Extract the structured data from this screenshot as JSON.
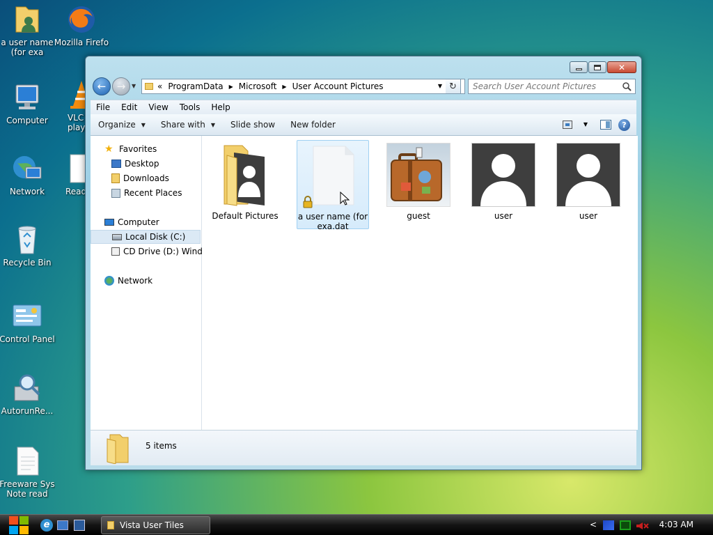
{
  "desktop": {
    "icons": [
      {
        "label": "a user name (for exa"
      },
      {
        "label": "Mozilla Firefo"
      },
      {
        "label": "Computer"
      },
      {
        "label": "VLC m play"
      },
      {
        "label": "Network"
      },
      {
        "label": "Read"
      },
      {
        "label": "Recycle Bin"
      },
      {
        "label": "Control Panel"
      },
      {
        "label": "AutorunRe..."
      },
      {
        "label": "Freeware Sys Note read this"
      }
    ]
  },
  "window": {
    "address": {
      "overflow": "«",
      "crumbs": [
        "ProgramData",
        "Microsoft",
        "User Account Pictures"
      ]
    },
    "search_placeholder": "Search User Account Pictures",
    "menu": [
      "File",
      "Edit",
      "View",
      "Tools",
      "Help"
    ],
    "toolbar": {
      "organize": "Organize",
      "share_with": "Share with",
      "slide_show": "Slide show",
      "new_folder": "New folder"
    },
    "nav": {
      "favorites": "Favorites",
      "desktop": "Desktop",
      "downloads": "Downloads",
      "recent_places": "Recent Places",
      "computer": "Computer",
      "local_disk": "Local Disk (C:)",
      "cd_drive": "CD Drive (D:) Windo",
      "network": "Network"
    },
    "files": [
      {
        "name": "Default Pictures",
        "type": "folder"
      },
      {
        "name": "a user name (for exa.dat",
        "type": "locked-file"
      },
      {
        "name": "guest",
        "type": "picture"
      },
      {
        "name": "user",
        "type": "picture"
      },
      {
        "name": "user",
        "type": "picture"
      }
    ],
    "status": "5 items"
  },
  "taskbar": {
    "task_label": "Vista User Tiles",
    "clock": "4:03 AM",
    "tray_expand": "<"
  }
}
